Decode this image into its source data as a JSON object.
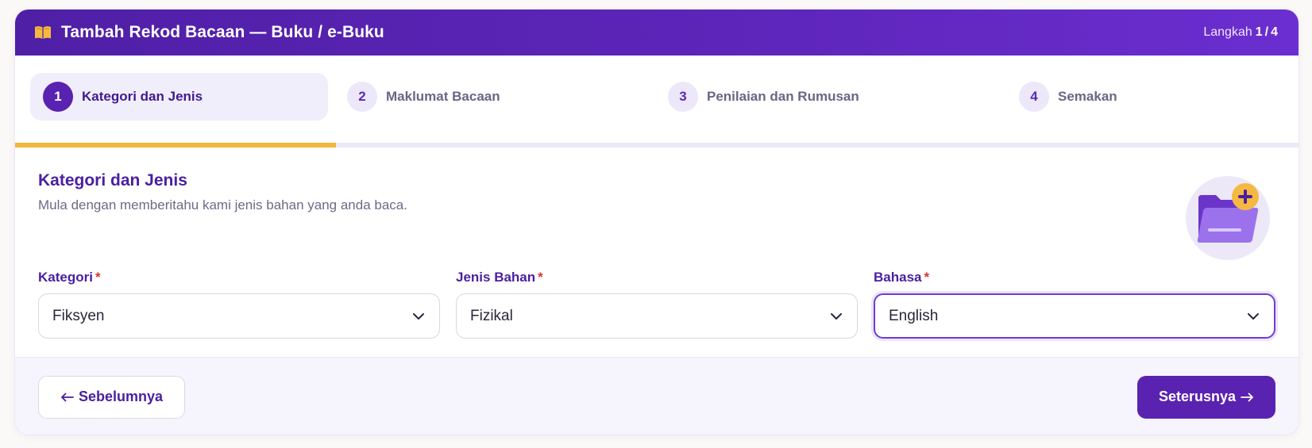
{
  "header": {
    "title": "Tambah Rekod Bacaan — Buku / e-Buku",
    "icon": "open-book-icon",
    "step_prefix": "Langkah",
    "current_step": "1",
    "total_steps": "4"
  },
  "stepper": {
    "progress_fraction": 0.25,
    "steps": [
      {
        "number": "1",
        "label": "Kategori dan Jenis",
        "active": true
      },
      {
        "number": "2",
        "label": "Maklumat Bacaan",
        "active": false
      },
      {
        "number": "3",
        "label": "Penilaian dan Rumusan",
        "active": false
      },
      {
        "number": "4",
        "label": "Semakan",
        "active": false
      }
    ]
  },
  "section": {
    "title": "Kategori dan Jenis",
    "subtitle": "Mula dengan memberitahu kami jenis bahan yang anda baca.",
    "illustration_icon": "folder-add-icon"
  },
  "fields": [
    {
      "label": "Kategori",
      "required_mark": "*",
      "value": "Fiksyen"
    },
    {
      "label": "Jenis Bahan",
      "required_mark": "*",
      "value": "Fizikal"
    },
    {
      "label": "Bahasa",
      "required_mark": "*",
      "value": "English"
    }
  ],
  "footer": {
    "prev_label": "Sebelumnya",
    "next_label": "Seterusnya"
  },
  "colors": {
    "primary": "#5a22b0",
    "accent": "#f3b53a",
    "required": "#d9342b"
  }
}
